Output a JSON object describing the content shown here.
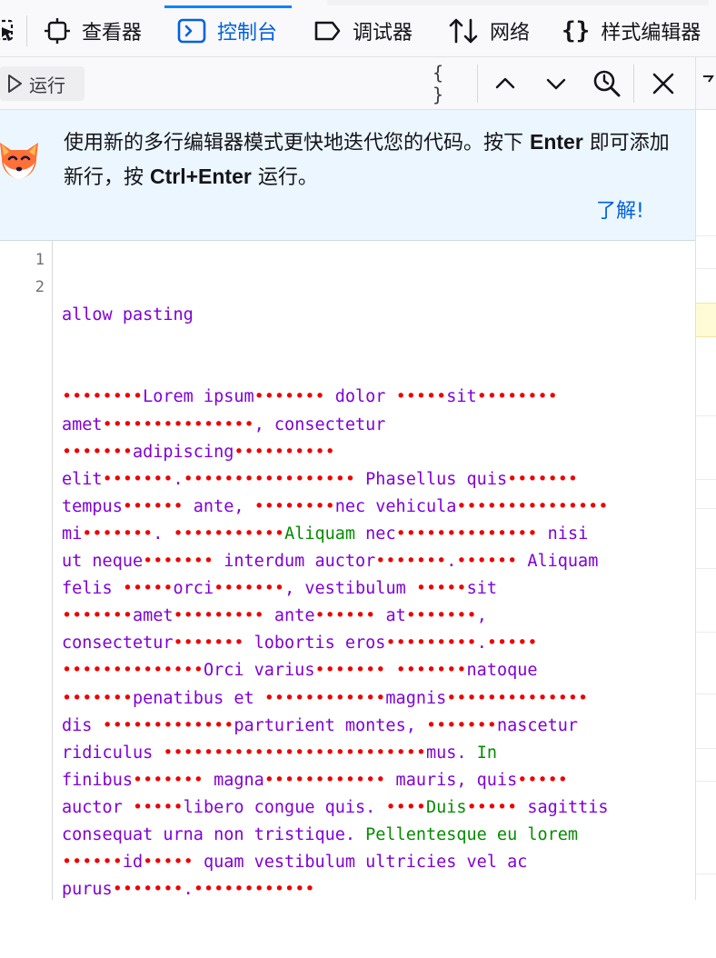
{
  "tabs": [
    {
      "label": "查看器",
      "icon": "inspector-icon"
    },
    {
      "label": "控制台",
      "icon": "console-icon",
      "selected": true
    },
    {
      "label": "调试器",
      "icon": "debugger-icon"
    },
    {
      "label": "网络",
      "icon": "network-icon"
    },
    {
      "label": "样式编辑器",
      "icon": "style-editor-icon"
    }
  ],
  "toolbar": {
    "run_label": "运行",
    "pretty_print_label": "{ }"
  },
  "notice": {
    "text_part1": "使用新的多行编辑器模式更快地迭代您的代码。按下 ",
    "enter_key": "Enter",
    "text_part2": " 即可添加新行，按 ",
    "ctrl_enter_key": "Ctrl+Enter",
    "text_part3": " 运行。",
    "link_label": "了解!"
  },
  "editor": {
    "line_numbers": [
      "1",
      "2"
    ],
    "line1": "allow pasting",
    "line2_rows": [
      [
        [
          "d",
          "••••••••"
        ],
        [
          "p",
          "Lorem ipsum"
        ],
        [
          "d",
          "•••••••"
        ],
        [
          "p",
          " dolor "
        ],
        [
          "d",
          "•••••"
        ],
        [
          "p",
          "sit"
        ],
        [
          "d",
          "••••••••"
        ]
      ],
      [
        [
          "p",
          "amet"
        ],
        [
          "d",
          "•••••••••••••••"
        ],
        [
          "p",
          ", consectetur"
        ]
      ],
      [
        [
          "d",
          "•••••••"
        ],
        [
          "p",
          "adipiscing"
        ],
        [
          "d",
          "••••••••••"
        ]
      ],
      [
        [
          "p",
          "elit"
        ],
        [
          "d",
          "•••••••"
        ],
        [
          "p",
          "."
        ],
        [
          "d",
          "•••••••••••••••••"
        ],
        [
          "p",
          " Phasellus quis"
        ],
        [
          "d",
          "•••••••"
        ]
      ],
      [
        [
          "p",
          "tempus"
        ],
        [
          "d",
          "••••••"
        ],
        [
          "p",
          " ante, "
        ],
        [
          "d",
          "••••••••"
        ],
        [
          "p",
          "nec vehicula"
        ],
        [
          "d",
          "•••••••••••••••"
        ]
      ],
      [
        [
          "p",
          "mi"
        ],
        [
          "d",
          "•••••••"
        ],
        [
          "p",
          ". "
        ],
        [
          "d",
          "•••••••••••"
        ],
        [
          "g",
          "Aliquam"
        ],
        [
          "p",
          " nec"
        ],
        [
          "d",
          "••••••••••••••"
        ],
        [
          "p",
          " nisi"
        ]
      ],
      [
        [
          "p",
          "ut neque"
        ],
        [
          "d",
          "•••••••"
        ],
        [
          "p",
          " interdum auctor"
        ],
        [
          "d",
          "•••••••"
        ],
        [
          "p",
          "."
        ],
        [
          "d",
          "••••••"
        ],
        [
          "p",
          " Aliquam"
        ]
      ],
      [
        [
          "p",
          "felis "
        ],
        [
          "d",
          "•••••"
        ],
        [
          "p",
          "orci"
        ],
        [
          "d",
          "•••••••"
        ],
        [
          "p",
          ", vestibulum "
        ],
        [
          "d",
          "•••••"
        ],
        [
          "p",
          "sit"
        ]
      ],
      [
        [
          "d",
          "•••••••"
        ],
        [
          "p",
          "amet"
        ],
        [
          "d",
          "•••••••••"
        ],
        [
          "p",
          " ante"
        ],
        [
          "d",
          "••••••"
        ],
        [
          "p",
          " at"
        ],
        [
          "d",
          "•••••••"
        ],
        [
          "p",
          ","
        ]
      ],
      [
        [
          "p",
          "consectetur"
        ],
        [
          "d",
          "•••••••"
        ],
        [
          "p",
          " lobortis eros"
        ],
        [
          "d",
          "•••••••••"
        ],
        [
          "p",
          "."
        ],
        [
          "d",
          "•••••"
        ]
      ],
      [
        [
          "d",
          "••••••••••••••"
        ],
        [
          "p",
          "Orci varius"
        ],
        [
          "d",
          "•••••••"
        ],
        [
          "p",
          " "
        ],
        [
          "d",
          "•••••••"
        ],
        [
          "p",
          "natoque"
        ]
      ],
      [
        [
          "d",
          "•••••••"
        ],
        [
          "p",
          "penatibus et "
        ],
        [
          "d",
          "••••••••••••"
        ],
        [
          "p",
          "magnis"
        ],
        [
          "d",
          "••••••••••••••"
        ]
      ],
      [
        [
          "p",
          "dis "
        ],
        [
          "d",
          "•••••••••••••"
        ],
        [
          "p",
          "parturient montes, "
        ],
        [
          "d",
          "•••••••"
        ],
        [
          "p",
          "nascetur"
        ]
      ],
      [
        [
          "p",
          "ridiculus "
        ],
        [
          "d",
          "••••••••••••••••••••••••••"
        ],
        [
          "p",
          "mus. "
        ],
        [
          "g",
          "In"
        ]
      ],
      [
        [
          "p",
          "finibus"
        ],
        [
          "d",
          "•••••••"
        ],
        [
          "p",
          " magna"
        ],
        [
          "d",
          "••••••••••••"
        ],
        [
          "p",
          " mauris, quis"
        ],
        [
          "d",
          "•••••"
        ]
      ],
      [
        [
          "p",
          "auctor "
        ],
        [
          "d",
          "•••••"
        ],
        [
          "p",
          "libero congue quis. "
        ],
        [
          "d",
          "••••"
        ],
        [
          "g",
          "Duis"
        ],
        [
          "d",
          "•••••"
        ],
        [
          "p",
          " sagittis"
        ]
      ],
      [
        [
          "p",
          "consequat urna non tristique. "
        ],
        [
          "g",
          "Pellentesque eu lorem"
        ]
      ],
      [
        [
          "d",
          "••••••"
        ],
        [
          "p",
          "id"
        ],
        [
          "d",
          "•••••"
        ],
        [
          "p",
          " quam vestibulum ultricies vel ac"
        ]
      ],
      [
        [
          "p",
          "purus"
        ],
        [
          "d",
          "•••••••"
        ],
        [
          "p",
          "."
        ],
        [
          "d",
          "••••••••••••"
        ]
      ]
    ]
  }
}
